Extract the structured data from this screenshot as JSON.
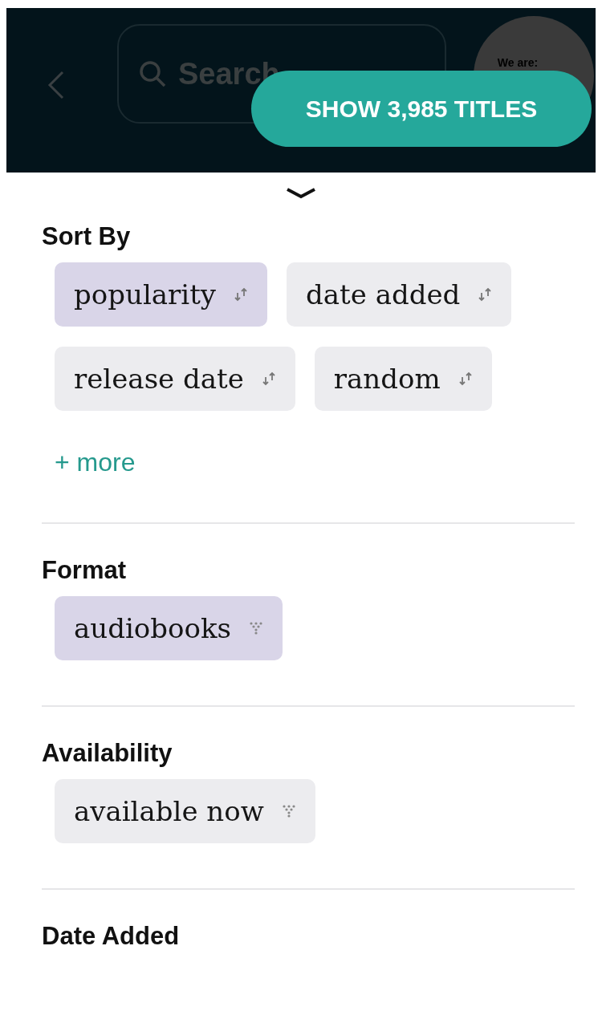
{
  "header": {
    "search": {
      "placeholder": "Search"
    },
    "avatar_text": "We are:",
    "show_button": "SHOW 3,985 TITLES"
  },
  "sections": [
    {
      "title": "Sort By",
      "options": [
        {
          "label": "popularity",
          "kind": "sort",
          "selected": true
        },
        {
          "label": "date added",
          "kind": "sort",
          "selected": false
        },
        {
          "label": "release date",
          "kind": "sort",
          "selected": false
        },
        {
          "label": "random",
          "kind": "sort",
          "selected": false
        }
      ],
      "more": "+ more"
    },
    {
      "title": "Format",
      "options": [
        {
          "label": "audiobooks",
          "kind": "filter",
          "selected": true
        }
      ]
    },
    {
      "title": "Availability",
      "options": [
        {
          "label": "available now",
          "kind": "filter",
          "selected": false
        }
      ]
    },
    {
      "title": "Date Added"
    }
  ]
}
